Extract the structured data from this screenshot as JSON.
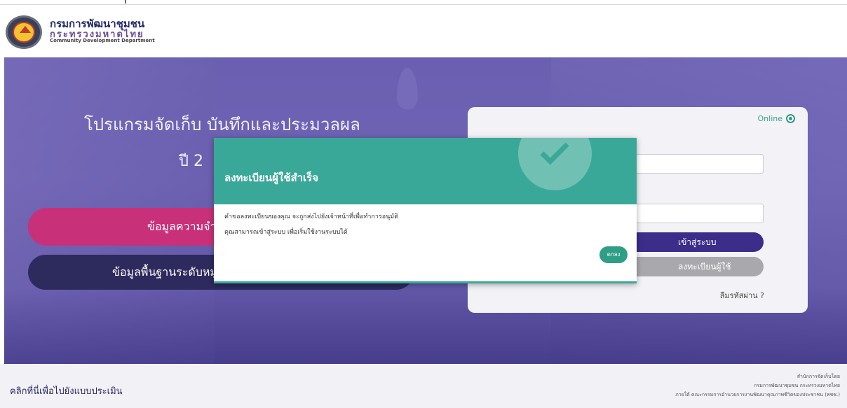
{
  "header": {
    "brand_th_line1": "กรมการพัฒนาชุมชน",
    "brand_th_line2": "กระทรวงมหาดไทย",
    "brand_en": "Community Development Department"
  },
  "hero": {
    "title_line1": "โปรแกรมจัดเก็บ บันทึกและประมวลผล",
    "title_line2": "ปี 2",
    "pink_button_label": "ข้อมูลความจำเป็นพื้นฐาน",
    "navy_button_label": "ข้อมูลพื้นฐานระดับหมู่บ้าน"
  },
  "login": {
    "online_label": "Online",
    "login_button_label": "เข้าสู่ระบบ",
    "register_button_label": "ลงทะเบียนผู้ใช้",
    "forgot_password_label": "ลืมรหัสผ่าน ?"
  },
  "modal": {
    "title": "ลงทะเบียนผู้ใช้สำเร็จ",
    "message_line1": "คำขอลงทะเบียนของคุณ จะถูกส่งไปยังเจ้าหน้าที่เพื่อทำการอนุมัติ",
    "message_line2": "คุณสามารถเข้าสู่ระบบ เพื่อเริ่มใช้งานระบบได้",
    "ok_button_label": "ตกลง"
  },
  "footer": {
    "evaluation_link": "คลิกที่นี่เพื่อไปยังแบบประเมิน",
    "credit_line1": "สำนักการจัดเก็บโดย",
    "credit_line2": "กรมการพัฒนาชุมชน กระทรวงมหาดไทย",
    "credit_line3": "ภายใต้ คณะกรรมการอำนวยการงานพัฒนาคุณภาพชีวิตของประชาชน (พชช.)"
  },
  "colors": {
    "accent_teal": "#3aa898",
    "primary_purple": "#3d2d8a",
    "pink": "#c9307a",
    "navy": "#2d2a5e"
  }
}
